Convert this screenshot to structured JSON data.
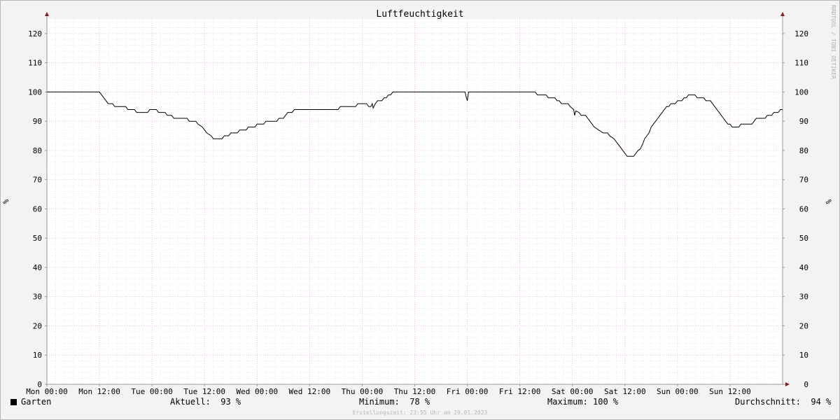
{
  "chart_data": {
    "type": "line",
    "title": "Luftfeuchtigkeit",
    "ylabel": "%",
    "ylim": [
      0,
      125
    ],
    "yticks": [
      0,
      10,
      20,
      30,
      40,
      50,
      60,
      70,
      80,
      90,
      100,
      110,
      120
    ],
    "xlim": [
      0,
      168
    ],
    "xtick_hours": [
      0,
      12,
      24,
      36,
      48,
      60,
      72,
      84,
      96,
      108,
      120,
      132,
      144,
      156
    ],
    "xtick_labels": [
      "Mon 00:00",
      "Mon 12:00",
      "Tue 00:00",
      "Tue 12:00",
      "Wed 00:00",
      "Wed 12:00",
      "Thu 00:00",
      "Thu 12:00",
      "Fri 00:00",
      "Fri 12:00",
      "Sat 00:00",
      "Sat 12:00",
      "Sun 00:00",
      "Sun 12:00"
    ],
    "grid": true,
    "series": [
      {
        "name": "Garten",
        "color": "#000000",
        "points": [
          [
            0,
            100
          ],
          [
            12,
            100
          ],
          [
            12.5,
            99
          ],
          [
            13,
            98
          ],
          [
            13.5,
            97
          ],
          [
            14,
            96
          ],
          [
            15,
            96
          ],
          [
            15.5,
            95
          ],
          [
            17,
            95
          ],
          [
            18,
            95
          ],
          [
            18.5,
            94
          ],
          [
            20,
            94
          ],
          [
            20.5,
            93
          ],
          [
            22,
            93
          ],
          [
            23,
            93
          ],
          [
            23.5,
            94
          ],
          [
            24.5,
            94
          ],
          [
            25,
            94
          ],
          [
            25.5,
            93
          ],
          [
            26.5,
            93
          ],
          [
            27,
            93
          ],
          [
            27.5,
            92
          ],
          [
            28.5,
            92
          ],
          [
            29,
            91
          ],
          [
            31,
            91
          ],
          [
            32,
            91
          ],
          [
            32.5,
            90
          ],
          [
            34,
            90
          ],
          [
            34.5,
            89
          ],
          [
            35.5,
            88
          ],
          [
            36,
            87
          ],
          [
            36.5,
            86
          ],
          [
            37,
            85.5
          ],
          [
            37.5,
            85
          ],
          [
            38,
            84
          ],
          [
            40,
            84
          ],
          [
            40.5,
            85
          ],
          [
            41.5,
            85
          ],
          [
            42,
            86
          ],
          [
            43.5,
            86
          ],
          [
            44,
            87
          ],
          [
            45.5,
            87
          ],
          [
            46,
            88
          ],
          [
            47.5,
            88
          ],
          [
            48,
            89
          ],
          [
            49.5,
            89
          ],
          [
            50,
            90
          ],
          [
            52.5,
            90
          ],
          [
            53,
            91
          ],
          [
            54,
            91
          ],
          [
            54.5,
            92
          ],
          [
            55,
            93
          ],
          [
            56,
            93
          ],
          [
            56.5,
            94
          ],
          [
            60,
            94
          ],
          [
            65,
            94
          ],
          [
            66.5,
            94
          ],
          [
            67,
            95
          ],
          [
            70.5,
            95
          ],
          [
            71,
            96
          ],
          [
            73,
            96
          ],
          [
            73.5,
            95
          ],
          [
            74,
            95
          ],
          [
            74.3,
            96
          ],
          [
            74.5,
            94.5
          ],
          [
            75,
            96
          ],
          [
            75.5,
            97
          ],
          [
            76.5,
            97
          ],
          [
            77,
            98
          ],
          [
            77.5,
            98
          ],
          [
            78,
            99
          ],
          [
            78.5,
            99
          ],
          [
            79,
            100
          ],
          [
            84,
            100
          ],
          [
            95.5,
            100
          ],
          [
            95.8,
            98
          ],
          [
            96,
            97
          ],
          [
            96.3,
            100
          ],
          [
            100,
            100
          ],
          [
            111.5,
            100
          ],
          [
            112,
            99
          ],
          [
            114,
            99
          ],
          [
            114.5,
            98
          ],
          [
            116,
            98
          ],
          [
            116.5,
            97
          ],
          [
            117,
            97
          ],
          [
            117.5,
            96
          ],
          [
            119,
            96
          ],
          [
            119.5,
            95
          ],
          [
            120.3,
            94
          ],
          [
            120.5,
            92
          ],
          [
            120.8,
            93.5
          ],
          [
            121.5,
            93
          ],
          [
            122,
            92
          ],
          [
            123,
            92
          ],
          [
            123.5,
            91
          ],
          [
            124,
            90
          ],
          [
            124.5,
            89
          ],
          [
            125,
            88
          ],
          [
            126,
            87
          ],
          [
            127,
            86
          ],
          [
            128,
            86
          ],
          [
            128.5,
            85
          ],
          [
            129,
            84.5
          ],
          [
            129.5,
            84
          ],
          [
            130,
            83
          ],
          [
            130.5,
            82
          ],
          [
            131,
            81
          ],
          [
            131.5,
            80
          ],
          [
            132,
            79
          ],
          [
            132.5,
            78
          ],
          [
            134,
            78
          ],
          [
            134.5,
            79
          ],
          [
            135,
            80
          ],
          [
            135.5,
            80.5
          ],
          [
            136,
            82
          ],
          [
            136.5,
            84
          ],
          [
            137,
            85
          ],
          [
            137.5,
            86
          ],
          [
            138,
            88
          ],
          [
            138.5,
            89
          ],
          [
            139,
            90
          ],
          [
            139.5,
            91
          ],
          [
            140,
            92
          ],
          [
            140.5,
            93
          ],
          [
            141,
            94
          ],
          [
            141.5,
            95
          ],
          [
            142,
            95
          ],
          [
            142.5,
            96
          ],
          [
            143.5,
            96
          ],
          [
            144,
            97
          ],
          [
            145,
            97
          ],
          [
            145.5,
            98
          ],
          [
            146,
            98
          ],
          [
            146.5,
            99
          ],
          [
            148,
            99
          ],
          [
            148.5,
            98
          ],
          [
            150,
            98
          ],
          [
            150.5,
            97
          ],
          [
            151.5,
            97
          ],
          [
            152,
            96
          ],
          [
            152.5,
            95
          ],
          [
            153,
            94
          ],
          [
            153.5,
            93
          ],
          [
            154,
            92
          ],
          [
            154.5,
            91
          ],
          [
            155,
            90
          ],
          [
            155.5,
            89
          ],
          [
            156,
            89
          ],
          [
            156.5,
            88
          ],
          [
            158,
            88
          ],
          [
            158.5,
            89
          ],
          [
            161,
            89
          ],
          [
            161.5,
            90
          ],
          [
            162,
            91
          ],
          [
            164,
            91
          ],
          [
            164.5,
            92
          ],
          [
            165.5,
            92
          ],
          [
            166,
            93
          ],
          [
            167,
            93
          ],
          [
            167.5,
            94
          ],
          [
            168,
            94
          ]
        ]
      }
    ]
  },
  "legend": {
    "series_name": "Garten",
    "current": "Aktuell:  93 %",
    "minimum": "Minimum:  78 %",
    "maximum": "Maximum: 100 %",
    "average": "Durchschnitt:  94 %"
  },
  "vertical_label": "RRDTOOL / TOBI OETIKER",
  "footer": "Erstellungszeit: 23:55 Uhr am 29.01.2023"
}
